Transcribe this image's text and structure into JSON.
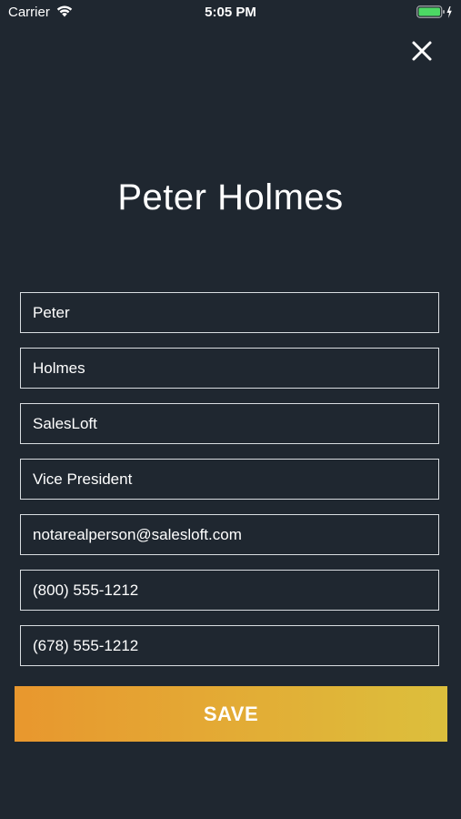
{
  "status_bar": {
    "carrier": "Carrier",
    "time": "5:05 PM"
  },
  "header": {
    "name": "Peter Holmes"
  },
  "form": {
    "first_name": "Peter",
    "last_name": "Holmes",
    "company": "SalesLoft",
    "title": "Vice President",
    "email": "notarealperson@salesloft.com",
    "phone_primary": "(800) 555-1212",
    "phone_secondary": "(678) 555-1212"
  },
  "actions": {
    "save_label": "SAVE"
  },
  "colors": {
    "background": "#1f2730",
    "field_border": "#d9dde1",
    "save_gradient_start": "#e8972e",
    "save_gradient_end": "#dcbf3c",
    "battery": "#4cd964"
  },
  "icons": {
    "wifi": "wifi-icon",
    "battery": "battery-icon",
    "charging": "charging-bolt-icon",
    "close": "close-icon"
  }
}
